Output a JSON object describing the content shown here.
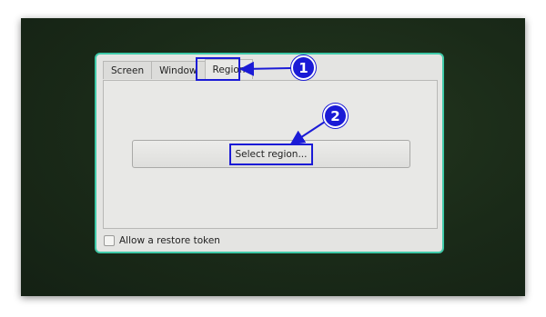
{
  "dialog": {
    "tabs": [
      {
        "label": "Screen",
        "active": false
      },
      {
        "label": "Window",
        "active": false
      },
      {
        "label": "Region",
        "active": true
      }
    ],
    "select_region_label": "Select region...",
    "restore_token_label": "Allow a restore token",
    "restore_token_checked": false
  },
  "annotations": {
    "callout_1": "1",
    "callout_2": "2",
    "color": "#1b1bd6"
  },
  "theme": {
    "dialog_border": "#3fc9a8",
    "background": "#1a2a18"
  }
}
